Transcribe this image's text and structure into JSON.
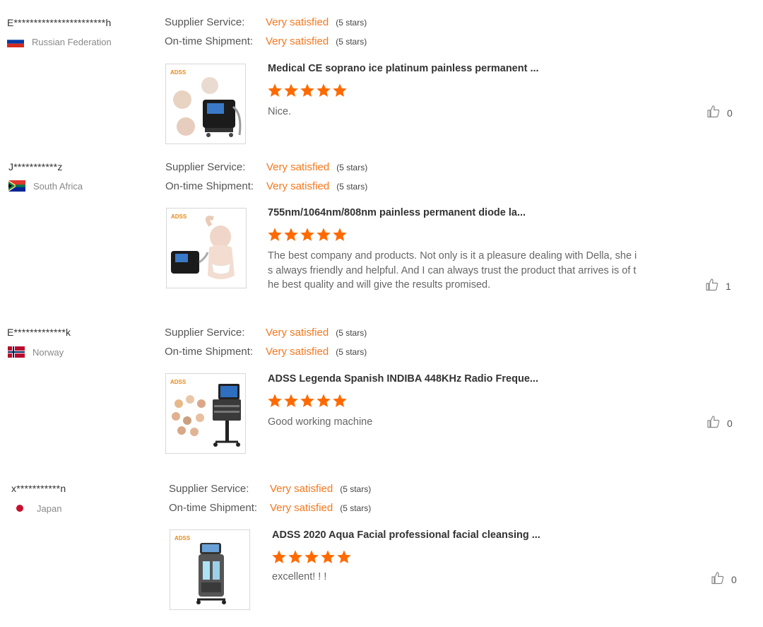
{
  "reviews": [
    {
      "user": "E***********************h",
      "country": "Russian Federation",
      "supplier_label": "Supplier Service:",
      "supplier_value": "Very satisfied",
      "supplier_stars": "(5 stars)",
      "shipment_label": "On-time Shipment:",
      "shipment_value": "Very satisfied",
      "shipment_stars": "(5 stars)",
      "product_title": "Medical CE soprano ice platinum painless permanent ...",
      "rating": 5,
      "text": "Nice.",
      "likes": "0",
      "flag": "russia"
    },
    {
      "user": "J***********z",
      "country": "South Africa",
      "supplier_label": "Supplier Service:",
      "supplier_value": "Very satisfied",
      "supplier_stars": "(5 stars)",
      "shipment_label": "On-time Shipment:",
      "shipment_value": "Very satisfied",
      "shipment_stars": "(5 stars)",
      "product_title": "755nm/1064nm/808nm painless permanent diode la...",
      "rating": 5,
      "text_lines": [
        "The best company and products. Not only is it a pleasure dealing with Della, she i",
        "s always friendly and helpful. And I can always trust the product that arrives is of t",
        "he best quality and will give the results promised."
      ],
      "likes": "1",
      "flag": "south-africa"
    },
    {
      "user": "E*************k",
      "country": "Norway",
      "supplier_label": "Supplier Service:",
      "supplier_value": "Very satisfied",
      "supplier_stars": "(5 stars)",
      "shipment_label": "On-time Shipment:",
      "shipment_value": "Very satisfied",
      "shipment_stars": "(5 stars)",
      "product_title": "ADSS Legenda Spanish INDIBA 448KHz Radio Freque...",
      "rating": 5,
      "text": "Good working machine",
      "likes": "0",
      "flag": "norway"
    },
    {
      "user": "x***********n",
      "country": "Japan",
      "supplier_label": "Supplier Service:",
      "supplier_value": "Very satisfied",
      "supplier_stars": "(5 stars)",
      "shipment_label": "On-time Shipment:",
      "shipment_value": "Very satisfied",
      "shipment_stars": "(5 stars)",
      "product_title": "ADSS 2020 Aqua Facial professional facial cleansing ...",
      "rating": 5,
      "text": "excellent! ! !",
      "likes": "0",
      "flag": "japan"
    }
  ],
  "brand_logo_text": "ADSS",
  "colors": {
    "accent": "#f5781e",
    "star": "#ff6a00",
    "muted": "#888888"
  }
}
